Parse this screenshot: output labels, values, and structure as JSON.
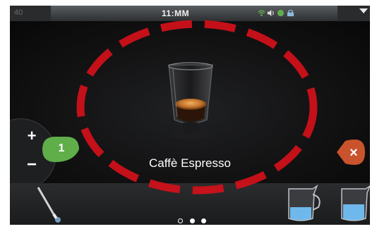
{
  "status_bar": {
    "left_text": "40",
    "time": "11:MM",
    "icons": [
      "wifi-icon",
      "volume-icon",
      "status-dot-icon",
      "lock-icon",
      "dropdown-arrow-icon"
    ]
  },
  "drink": {
    "name": "Caffè Espresso"
  },
  "quantity": {
    "value": "1",
    "plus_label": "+",
    "minus_label": "−"
  },
  "cancel": {
    "label": "×"
  },
  "carousel": {
    "items": [
      "milk-frother-wand-icon",
      "milk-jug-icon",
      "milk-jug-icon"
    ],
    "page_count": 3,
    "current_page": 1
  },
  "colors": {
    "accent_green": "#5fae4a",
    "cancel_orange": "#c9532d",
    "annotation_red": "#d3101a"
  }
}
